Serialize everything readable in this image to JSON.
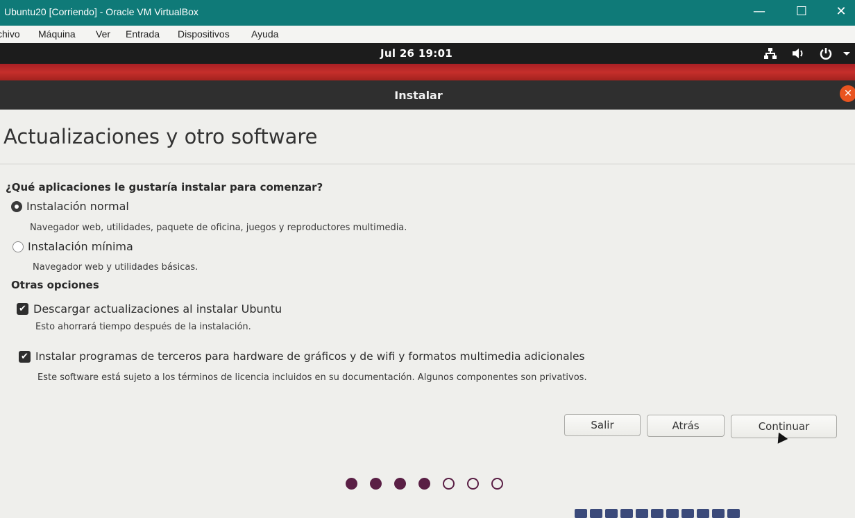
{
  "vbox": {
    "window_title": "Ubuntu20 [Corriendo] - Oracle VM VirtualBox",
    "minimize": "—",
    "maximize": "☐",
    "close": "✕",
    "menu": [
      "chivo",
      "Máquina",
      "Ver",
      "Entrada",
      "Dispositivos",
      "Ayuda"
    ]
  },
  "panel": {
    "clock": "Jul 26  19:01",
    "icons": [
      "network-icon",
      "volume-icon",
      "power-icon",
      "dropdown-icon"
    ]
  },
  "installer": {
    "title": "Instalar",
    "close_symbol": "✕",
    "page_title": "Actualizaciones y otro software",
    "question": "¿Qué aplicaciones le gustaría instalar para comenzar?",
    "options": [
      {
        "label": "Instalación normal",
        "description": "Navegador web, utilidades, paquete de oficina, juegos y reproductores multimedia.",
        "selected": true
      },
      {
        "label": "Instalación mínima",
        "description": "Navegador web y utilidades básicas.",
        "selected": false
      }
    ],
    "other_options_title": "Otras opciones",
    "checkboxes": [
      {
        "label": "Descargar actualizaciones al instalar Ubuntu",
        "description": "Esto ahorrará tiempo después de la instalación.",
        "checked": true
      },
      {
        "label": "Instalar programas de terceros para hardware de gráficos y de wifi y formatos multimedia adicionales",
        "description": "Este software está sujeto a los términos de licencia incluidos en su documentación. Algunos componentes son privativos.",
        "checked": true
      }
    ],
    "buttons": {
      "quit": "Salir",
      "back": "Atrás",
      "continue": "Continuar"
    },
    "progress": {
      "total_steps": 7,
      "completed_steps": 4
    },
    "accent_color": "#e95420",
    "dot_color": "#5a1f45"
  }
}
